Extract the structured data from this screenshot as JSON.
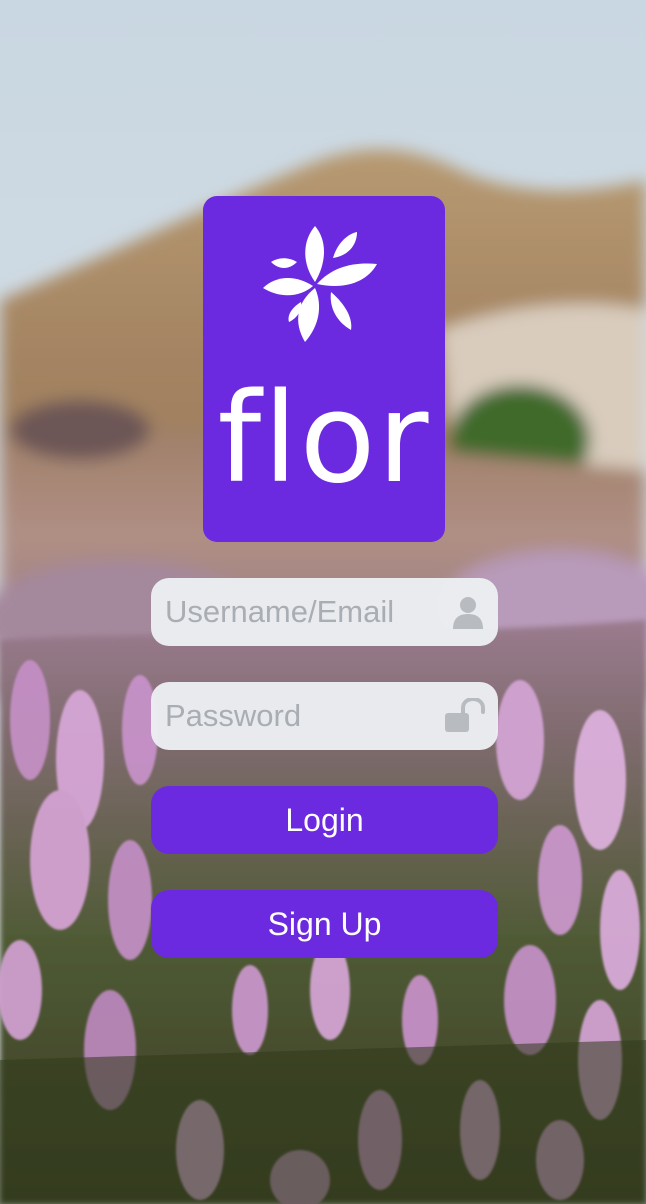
{
  "colors": {
    "brand": "#6c2ae0",
    "field_background": "#eceff2",
    "placeholder": "#a9aeb4",
    "button_text": "#ffffff"
  },
  "logo": {
    "word": "flor",
    "icon": "flower-icon"
  },
  "form": {
    "username_placeholder": "Username/Email",
    "username_icon": "user-icon",
    "password_placeholder": "Password",
    "password_icon": "unlock-icon",
    "login_label": "Login",
    "signup_label": "Sign Up"
  }
}
